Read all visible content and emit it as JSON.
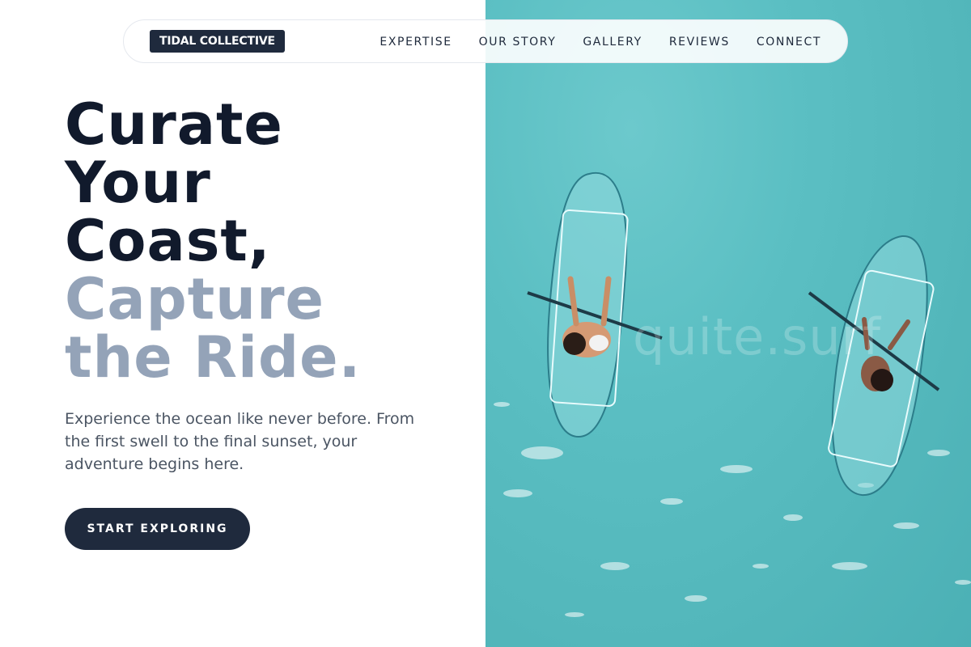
{
  "brand": {
    "logo_text": "TIDAL COLLECTIVE"
  },
  "nav": {
    "items": [
      "EXPERTISE",
      "OUR STORY",
      "GALLERY",
      "REVIEWS",
      "CONNECT"
    ]
  },
  "hero": {
    "headline_dark": [
      "Curate",
      "Your",
      "Coast,"
    ],
    "headline_muted": [
      "Capture",
      "the Ride."
    ],
    "intro": "Experience the ocean like never before. From the first swell to the final sunset, your adventure begins here.",
    "cta_label": "START EXPLORING"
  },
  "image": {
    "watermark": "quite.surf",
    "description_icon": "kayak-photo"
  },
  "colors": {
    "dark": "#111a2c",
    "muted": "#94a3b8",
    "button": "#1f2a3d",
    "water": "#56bbbf"
  }
}
